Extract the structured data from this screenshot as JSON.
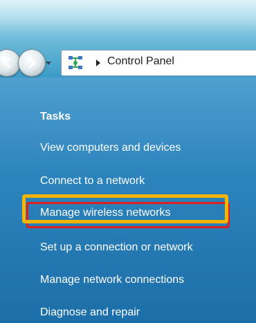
{
  "address_bar": {
    "breadcrumb": "Control Panel",
    "icon": "network-and-sharing-icon"
  },
  "tasks_pane": {
    "title": "Tasks",
    "items": [
      {
        "label": "View computers and devices"
      },
      {
        "label": "Connect to a network"
      },
      {
        "label": "Manage wireless networks",
        "highlighted": true
      },
      {
        "label": "Set up a connection or network"
      },
      {
        "label": "Manage network connections"
      },
      {
        "label": "Diagnose and repair"
      }
    ]
  },
  "colors": {
    "pane_background": "#2d84bd",
    "highlight_outer": "#f7b500",
    "highlight_inner": "#e21d1d"
  }
}
